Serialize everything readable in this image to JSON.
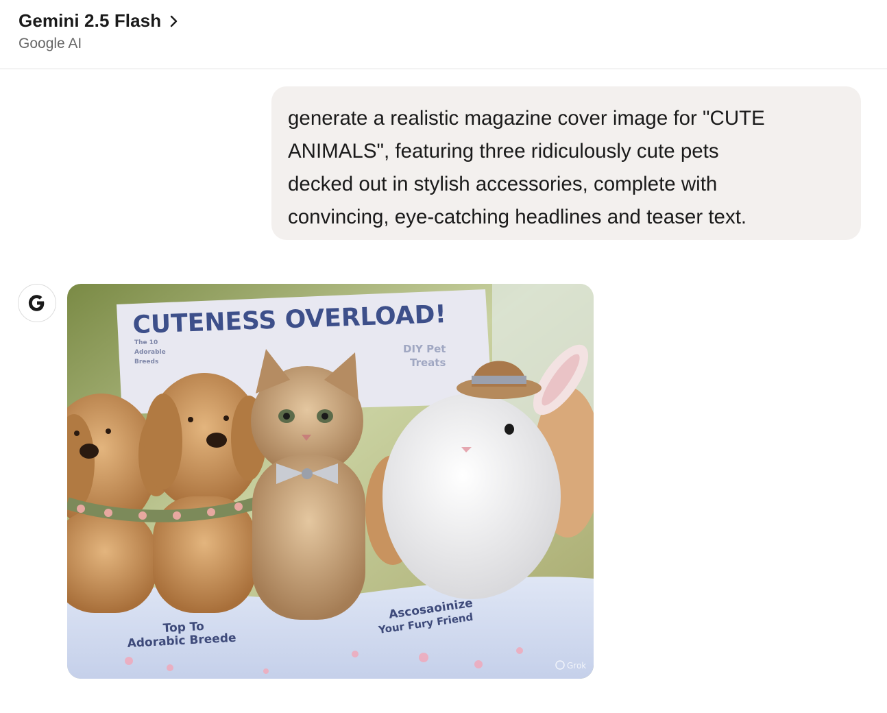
{
  "header": {
    "title": "Gemini 2.5 Flash",
    "subtitle": "Google AI",
    "chevron_icon": "chevron-right-icon"
  },
  "conversation": {
    "user_message": "generate a realistic magazine cover image for \"CUTE\nANIMALS\", featuring three ridiculously cute pets\ndecked out in stylish accessories, complete with\nconvincing, eye-catching headlines and teaser text.",
    "assistant_avatar": "google-g-logo",
    "generated_image": {
      "banner_text": "CUTENESS OVERLOAD!",
      "teaser_left": [
        "The 10",
        "Adorable",
        "Breeds"
      ],
      "teaser_right": [
        "DIY Pet",
        "Treats"
      ],
      "bottom_left": [
        "Top To",
        "Adorabic Breede"
      ],
      "bottom_right": [
        "Ascosaoinize",
        "Your Fury Friend"
      ],
      "watermark": "Grok"
    }
  }
}
